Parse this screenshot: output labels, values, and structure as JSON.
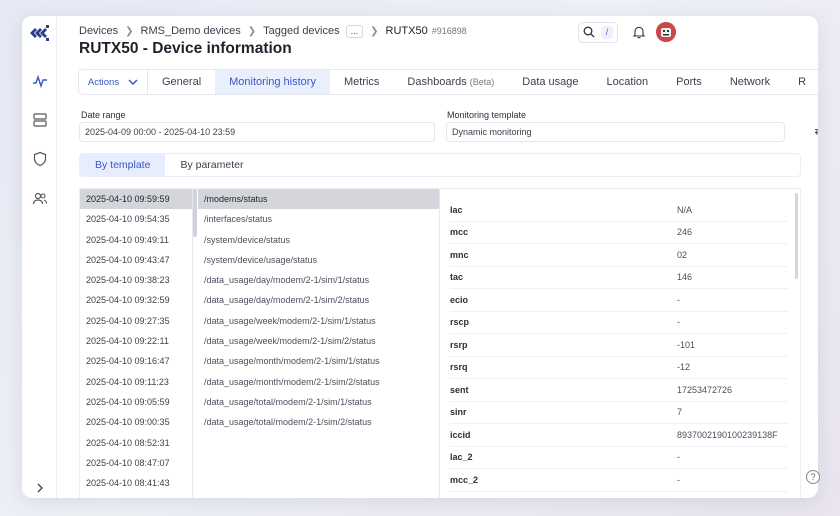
{
  "breadcrumb": {
    "items": [
      "Devices",
      "RMS_Demo devices",
      "Tagged devices"
    ],
    "more": "...",
    "current": "RUTX50",
    "serial": "#916898"
  },
  "page_title": "RUTX50 - Device information",
  "search": {
    "shortcut": "/"
  },
  "tabs": {
    "actions": "Actions",
    "items": [
      {
        "label": "General"
      },
      {
        "label": "Monitoring history",
        "active": true
      },
      {
        "label": "Metrics"
      },
      {
        "label": "Dashboards",
        "badge": "(Beta)"
      },
      {
        "label": "Data usage"
      },
      {
        "label": "Location"
      },
      {
        "label": "Ports"
      },
      {
        "label": "Network"
      },
      {
        "label": "R"
      }
    ]
  },
  "filters": {
    "date_range_label": "Date range",
    "date_range_value": "2025-04-09 00:00 - 2025-04-10 23:59",
    "template_label": "Monitoring template",
    "template_value": "Dynamic monitoring"
  },
  "subtabs": [
    "By template",
    "By parameter"
  ],
  "timestamps": [
    "2025-04-10 09:59:59",
    "2025-04-10 09:54:35",
    "2025-04-10 09:49:11",
    "2025-04-10 09:43:47",
    "2025-04-10 09:38:23",
    "2025-04-10 09:32:59",
    "2025-04-10 09:27:35",
    "2025-04-10 09:22:11",
    "2025-04-10 09:16:47",
    "2025-04-10 09:11:23",
    "2025-04-10 09:05:59",
    "2025-04-10 09:00:35",
    "2025-04-10 08:52:31",
    "2025-04-10 08:47:07",
    "2025-04-10 08:41:43"
  ],
  "paths": [
    "/modems/status",
    "/interfaces/status",
    "/system/device/status",
    "/system/device/usage/status",
    "/data_usage/day/modem/2-1/sim/1/status",
    "/data_usage/day/modem/2-1/sim/2/status",
    "/data_usage/week/modem/2-1/sim/1/status",
    "/data_usage/week/modem/2-1/sim/2/status",
    "/data_usage/month/modem/2-1/sim/1/status",
    "/data_usage/month/modem/2-1/sim/2/status",
    "/data_usage/total/modem/2-1/sim/1/status",
    "/data_usage/total/modem/2-1/sim/2/status"
  ],
  "details": [
    {
      "key": "lac",
      "value": "N/A"
    },
    {
      "key": "mcc",
      "value": "246"
    },
    {
      "key": "mnc",
      "value": "02"
    },
    {
      "key": "tac",
      "value": "146"
    },
    {
      "key": "ecio",
      "value": "-"
    },
    {
      "key": "rscp",
      "value": "-"
    },
    {
      "key": "rsrp",
      "value": "-101"
    },
    {
      "key": "rsrq",
      "value": "-12"
    },
    {
      "key": "sent",
      "value": "17253472726"
    },
    {
      "key": "sinr",
      "value": "7"
    },
    {
      "key": "iccid",
      "value": "8937002190100239138F"
    },
    {
      "key": "lac_2",
      "value": "-"
    },
    {
      "key": "mcc_2",
      "value": "-"
    }
  ],
  "help": "?",
  "colors": {
    "accent": "#3b57c4",
    "active_bg": "#e9effc",
    "selected_row": "#d3d5db"
  }
}
